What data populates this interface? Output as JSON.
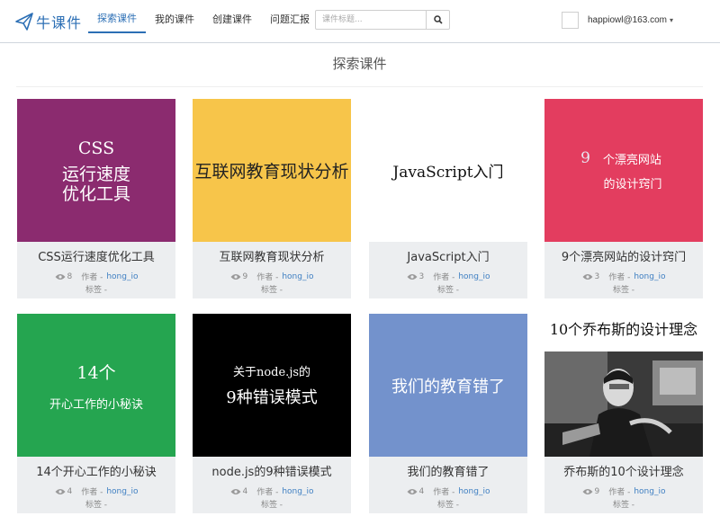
{
  "brand": {
    "name": "牛课件",
    "logo_icon": "paper-plane-icon",
    "color": "#2c6fb5"
  },
  "nav": {
    "items": [
      {
        "label": "探索课件",
        "active": true
      },
      {
        "label": "我的课件",
        "active": false
      },
      {
        "label": "创建课件",
        "active": false
      },
      {
        "label": "问题汇报",
        "active": false
      }
    ]
  },
  "search": {
    "placeholder": "课件标题...",
    "icon": "search-icon"
  },
  "user": {
    "email": "happiowl@163.com",
    "caret": "▾"
  },
  "page": {
    "title": "探索课件"
  },
  "labels": {
    "author": "作者 -",
    "tags": "标签 -"
  },
  "cards": [
    {
      "title": "CSS运行速度优化工具",
      "views": "8",
      "author": "hong_io",
      "cover_color": "#8b2b6f",
      "cover_lines": [
        "CSS",
        "运行速度",
        "优化工具"
      ]
    },
    {
      "title": "互联网教育现状分析",
      "views": "9",
      "author": "hong_io",
      "cover_color": "#f7c54a",
      "cover_lines": [
        "互联网教育现状分析"
      ]
    },
    {
      "title": "JavaScript入门",
      "views": "3",
      "author": "hong_io",
      "cover_color": "#ffffff",
      "cover_lines": [
        "JavaScript入门"
      ]
    },
    {
      "title": "9个漂亮网站的设计窍门",
      "views": "3",
      "author": "hong_io",
      "cover_color": "#e33d5f",
      "cover_lines": [
        "9",
        "个漂亮网站",
        "的设计窍门"
      ]
    },
    {
      "title": "14个开心工作的小秘诀",
      "views": "4",
      "author": "hong_io",
      "cover_color": "#25a550",
      "cover_lines": [
        "14个",
        "开心工作的小秘诀"
      ]
    },
    {
      "title": "node.js的9种错误模式",
      "views": "4",
      "author": "hong_io",
      "cover_color": "#000000",
      "cover_lines": [
        "关于node.js的",
        "9种错误模式"
      ]
    },
    {
      "title": "我们的教育错了",
      "views": "4",
      "author": "hong_io",
      "cover_color": "#7392cc",
      "cover_lines": [
        "我们的教育错了"
      ]
    },
    {
      "title": "乔布斯的10个设计理念",
      "views": "9",
      "author": "hong_io",
      "cover_color": "#ffffff",
      "cover_lines": [
        "10个乔布斯的设计理念"
      ]
    }
  ]
}
